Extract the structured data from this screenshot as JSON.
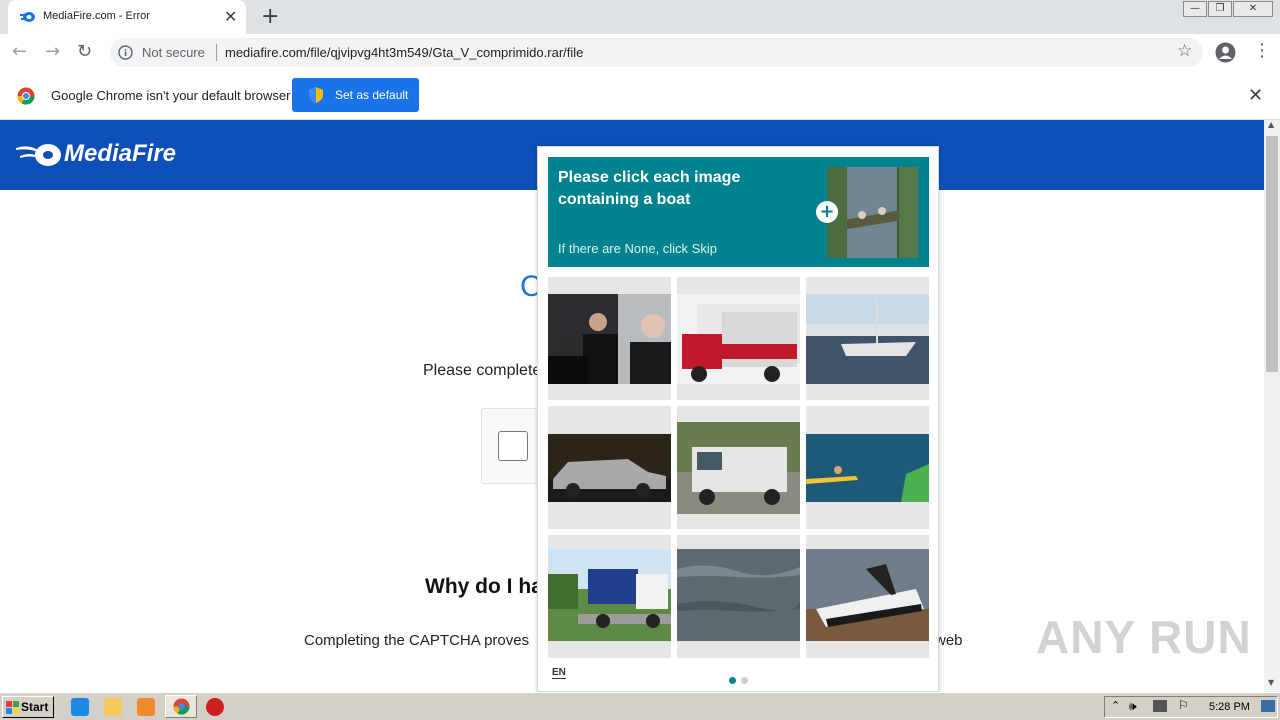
{
  "browser": {
    "tab_title": "MediaFire.com - Error",
    "security_label": "Not secure",
    "url": "mediafire.com/file/qjvipvg4ht3m549/Gta_V_comprimido.rar/file"
  },
  "infobar": {
    "message": "Google Chrome isn't your default browser",
    "button_label": "Set as default"
  },
  "page": {
    "logo_text": "MediaFire",
    "partial_heading": "C",
    "partial_instruction": "Please complete",
    "partial_why": "Why do I ha",
    "partial_completing": "Completing the CAPTCHA proves",
    "partial_web": "web"
  },
  "captcha": {
    "prompt_title": "Please click each image containing a boat",
    "prompt_subtitle": "If there are None, click Skip",
    "language": "EN",
    "accent_color": "#00838f",
    "tiles": [
      "people-in-jackets",
      "red-fire-truck",
      "boats-at-marina",
      "silver-car",
      "white-truck",
      "kayakers-on-water",
      "dump-truck",
      "water-surface",
      "speedboat-on-trailer"
    ]
  },
  "watermark": "ANY RUN",
  "taskbar": {
    "start_label": "Start",
    "clock": "5:28 PM"
  }
}
